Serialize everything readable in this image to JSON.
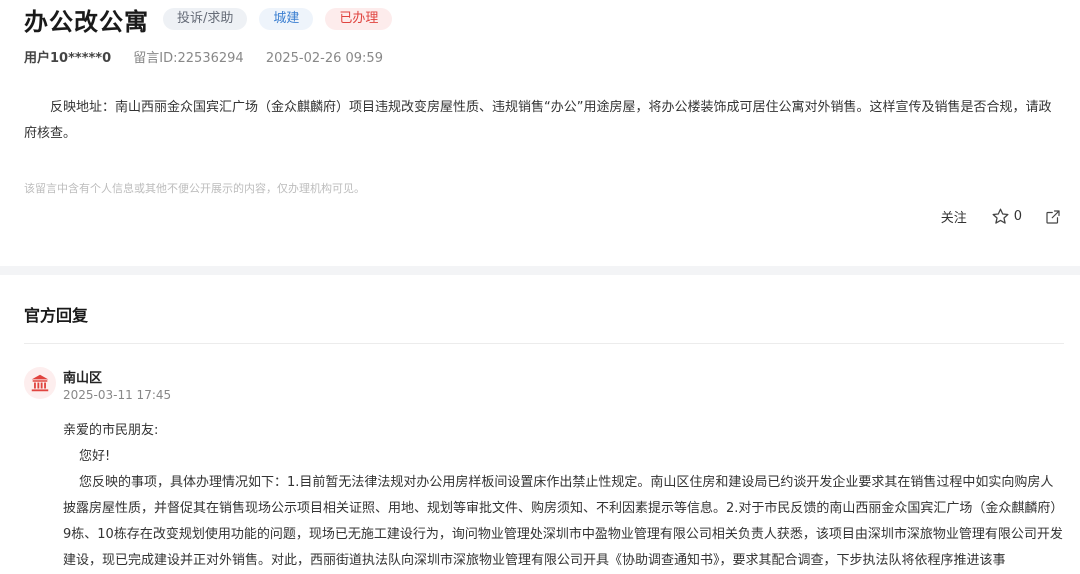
{
  "header": {
    "title": "办公改公寓",
    "tags": [
      {
        "label": "投诉/求助"
      },
      {
        "label": "城建"
      },
      {
        "label": "已办理"
      }
    ],
    "user": "用户10*****0",
    "message_id": "留言ID:22536294",
    "datetime": "2025-02-26 09:59"
  },
  "content": {
    "text": "反映地址：南山西丽金众国宾汇广场（金众麒麟府）项目违规改变房屋性质、违规销售“办公”用途房屋，将办公楼装饰成可居住公寓对外销售。这样宣传及销售是否合规，请政府核查。",
    "privacy_notice": "该留言中含有个人信息或其他不便公开展示的内容，仅办理机构可见。"
  },
  "actions": {
    "follow_label": "关注",
    "star_count": "0",
    "icons": [
      "star-icon",
      "share-icon"
    ]
  },
  "reply": {
    "section_title": "官方回复",
    "org_icon": "government-building-icon",
    "org_name": "南山区",
    "time": "2025-03-11 17:45",
    "greeting": "亲爱的市民朋友:",
    "hello": "您好!",
    "body": "您反映的事项，具体办理情况如下：1.目前暂无法律法规对办公用房样板间设置床作出禁止性规定。南山区住房和建设局已约谈开发企业要求其在销售过程中如实向购房人披露房屋性质，并督促其在销售现场公示项目相关证照、用地、规划等审批文件、购房须知、不利因素提示等信息。2.对于市民反馈的南山西丽金众国宾汇广场（金众麒麟府）9栋、10栋存在改变规划使用功能的问题，现场已无施工建设行为，询问物业管理处深圳市中盈物业管理有限公司相关负责人获悉，该项目由深圳市深旅物业管理有限公司开发建设，现已完成建设并正对外销售。对此，西丽街道执法队向深圳市深旅物业管理有限公司开具《协助调查通知书》，要求其配合调查，下步执法队将依程序推进该事"
  },
  "colors": {
    "tag_gray_bg": "#eef1f5",
    "tag_blue_text": "#3b7fd1",
    "tag_red_text": "#e0443f",
    "org_icon": "#e0443f"
  }
}
